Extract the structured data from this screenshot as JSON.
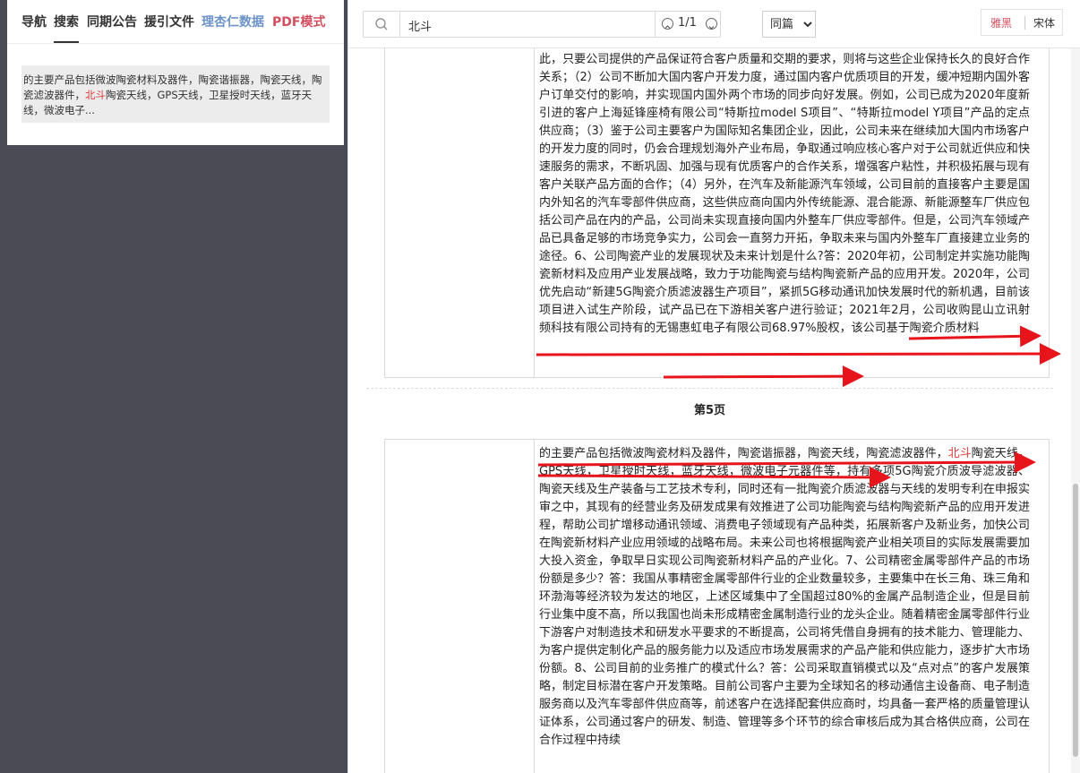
{
  "left_panel": {
    "tabs": [
      {
        "label": "导航",
        "style": "normal"
      },
      {
        "label": "搜索",
        "style": "active"
      },
      {
        "label": "同期公告",
        "style": "normal"
      },
      {
        "label": "援引文件",
        "style": "normal"
      },
      {
        "label": "理杏仁数据",
        "style": "blue"
      },
      {
        "label": "PDF模式",
        "style": "red"
      }
    ],
    "result": {
      "before": "的主要产品包括微波陶瓷材料及器件，陶瓷谐振器，陶瓷天线，陶瓷滤波器件，",
      "keyword": "北斗",
      "after": "陶瓷天线，GPS天线，卫星授时天线，蓝牙天线，微波电子..."
    }
  },
  "toolbar": {
    "search_value": "北斗",
    "counter": "1/1",
    "scope_options": [
      "同篇"
    ],
    "scope_selected": "同篇",
    "font_options": [
      "雅黑",
      "宋体"
    ]
  },
  "doc": {
    "page4_paragraph": "此，只要公司提供的产品保证符合客户质量和交期的要求，则将与这些企业保持长久的良好合作关系；（2）公司不断加大国内客户开发力度，通过国内客户优质项目的开发，缓冲短期内国外客户订单交付的影响，并实现国内国外两个市场的同步向好发展。例如，公司已成为2020年度新引进的客户上海延锋座椅有限公司“特斯拉model S项目”、“特斯拉model Y项目”产品的定点供应商；（3）鉴于公司主要客户为国际知名集团企业，因此，公司未来在继续加大国内市场客户的开发力度的同时，仍会合理规划海外产业布局，争取通过响应核心客户对于公司就近供应和快速服务的需求，不断巩固、加强与现有优质客户的合作关系，增强客户粘性，并积极拓展与现有客户关联产品方面的合作；（4）另外，在汽车及新能源汽车领域，公司目前的直接客户主要是国内外知名的汽车零部件供应商，这些供应商向国内外传统能源、混合能源、新能源整车厂供应包括公司产品在内的产品，公司尚未实现直接向国内外整车厂供应零部件。但是，公司汽车领域产品已具备足够的市场竞争实力，公司会一直努力开拓，争取未来与国内外整车厂直接建立业务的途径。6、公司陶瓷产业的发展现状及未来计划是什么?答：2020年初，公司制定并实施功能陶瓷新材料及应用产业发展战略，致力于功能陶瓷与结构陶瓷新产品的应用开发。2020年，公司优先启动“新建5G陶瓷介质滤波器生产项目”，紧抓5G移动通讯加快发展时代的新机遇，目前该项目进入试生产阶段，试产品已在下游相关客户进行验证；2021年2月，公司收购昆山立讯射频科技有限公司持有的无锡惠虹电子有限公司68.97%股权，该公司基于陶瓷介质材料",
    "page_label": "第5页",
    "page5": {
      "before": "的主要产品包括微波陶瓷材料及器件，陶瓷谐振器，陶瓷天线，陶瓷滤波器件，",
      "keyword": "北斗",
      "after": "陶瓷天线，GPS天线，卫星授时天线，蓝牙天线，微波电子元器件等，持有多项5G陶瓷介质波导滤波器、陶瓷天线及生产装备与工艺技术专利，同时还有一批陶瓷介质滤波器与天线的发明专利在申报实审之中，其现有的经营业务及研发成果有效推进了公司功能陶瓷与结构陶瓷新产品的应用开发进程，帮助公司扩增移动通讯领域、消费电子领域现有产品种类，拓展新客户及新业务，加快公司在陶瓷新材料产业应用领域的战略布局。未来公司也将根据陶瓷产业相关项目的实际发展需要加大投入资金，争取早日实现公司陶瓷新材料产品的产业化。7、公司精密金属零部件产品的市场份额是多少？答：我国从事精密金属零部件行业的企业数量较多，主要集中在长三角、珠三角和环渤海等经济较为发达的地区，上述区域集中了全国超过80%的金属产品制造企业，但是目前行业集中度不高，所以我国也尚未形成精密金属制造行业的龙头企业。随着精密金属零部件行业下游客户对制造技术和研发水平要求的不断提高，公司将凭借自身拥有的技术能力、管理能力、为客户提供定制化产品的服务能力以及适应市场发展需求的产品产能和供应能力，逐步扩大市场份额。8、公司目前的业务推广的模式什么？答：公司采取直销模式以及“点对点”的客户发展策略，制定目标潜在客户开发策略。目前公司客户主要为全球知名的移动通信主设备商、电子制造服务商以及汽车零部件供应商等，前述客户在选择配套供应商时，均具备一套严格的质量管理认证体系，公司通过客户的研发、制造、管理等多个环节的综合审核后成为其合格供应商，公司在合作过程中持续"
    }
  },
  "colors": {
    "highlight": "#e03c3c",
    "arrow": "#e8141c",
    "dark_bg": "#4a4b54"
  }
}
